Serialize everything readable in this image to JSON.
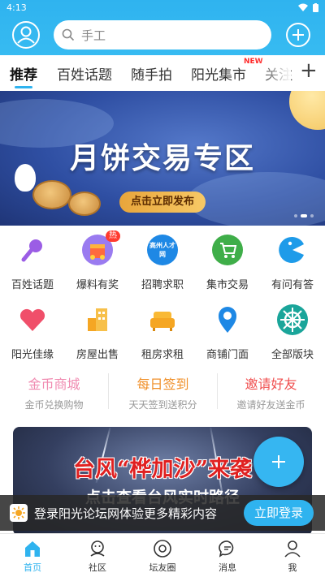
{
  "status": {
    "time": "4:13"
  },
  "search": {
    "placeholder": "手工"
  },
  "tabs": [
    {
      "label": "推荐",
      "active": true
    },
    {
      "label": "百姓话题"
    },
    {
      "label": "随手拍"
    },
    {
      "label": "阳光集市",
      "badge": "NEW"
    },
    {
      "label": "关注"
    }
  ],
  "tabs_more": "+",
  "banner": {
    "title": "月饼交易专区",
    "button": "点击立即发布"
  },
  "grid": [
    {
      "label": "百姓话题",
      "icon": "microphone-icon"
    },
    {
      "label": "爆料有奖",
      "icon": "gift-icon",
      "badge": "热"
    },
    {
      "label": "招聘求职",
      "icon": "job-icon",
      "icon_text": "高州人才网"
    },
    {
      "label": "集市交易",
      "icon": "cart-icon"
    },
    {
      "label": "有问有答",
      "icon": "qa-icon"
    },
    {
      "label": "阳光佳缘",
      "icon": "heart-icon"
    },
    {
      "label": "房屋出售",
      "icon": "building-icon"
    },
    {
      "label": "租房求租",
      "icon": "sofa-icon"
    },
    {
      "label": "商铺门面",
      "icon": "location-icon"
    },
    {
      "label": "全部版块",
      "icon": "helm-icon"
    }
  ],
  "quicklinks": [
    {
      "title": "金币商城",
      "subtitle": "金币兑换购物",
      "color": "#f08ab0"
    },
    {
      "title": "每日签到",
      "subtitle": "天天签到送积分",
      "color": "#f0902a"
    },
    {
      "title": "邀请好友",
      "subtitle": "邀请好友送金币",
      "color": "#f04f4f"
    }
  ],
  "storm": {
    "title": "台风“桦加沙”来袭",
    "subtitle": "点击查看台风实时路径"
  },
  "login": {
    "text": "登录阳光论坛网体验更多精彩内容",
    "button": "立即登录"
  },
  "nav": [
    {
      "label": "首页",
      "icon": "home-icon",
      "active": true
    },
    {
      "label": "社区",
      "icon": "community-icon"
    },
    {
      "label": "坛友圈",
      "icon": "circle-icon"
    },
    {
      "label": "消息",
      "icon": "message-icon"
    },
    {
      "label": "我",
      "icon": "profile-icon"
    }
  ],
  "colors": {
    "brand": "#2fb3ef",
    "hot": "#ff3b30"
  }
}
